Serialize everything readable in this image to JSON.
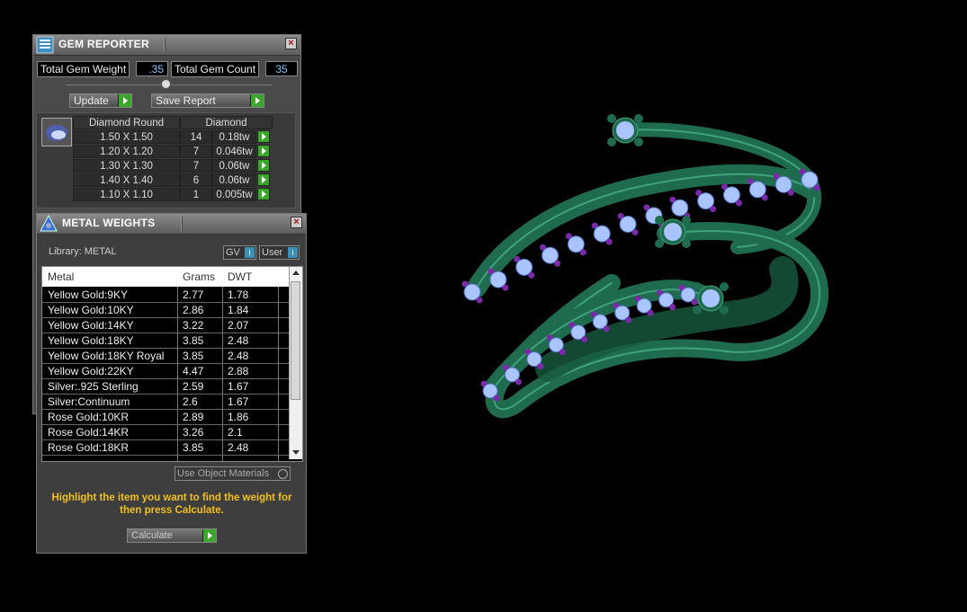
{
  "gem_reporter": {
    "title": "GEM REPORTER",
    "total_weight_label": "Total Gem Weight",
    "total_weight_value": ".35",
    "total_count_label": "Total Gem Count",
    "total_count_value": "35",
    "update_label": "Update",
    "save_label": "Save Report",
    "table": {
      "header_shape": "Diamond Round",
      "header_type": "Diamond",
      "rows": [
        {
          "size": "1.50 X 1.50",
          "qty": "14",
          "weight": "0.18tw"
        },
        {
          "size": "1.20 X 1.20",
          "qty": "7",
          "weight": "0.046tw"
        },
        {
          "size": "1.30 X 1.30",
          "qty": "7",
          "weight": "0.06tw"
        },
        {
          "size": "1.40 X 1.40",
          "qty": "6",
          "weight": "0.06tw"
        },
        {
          "size": "1.10 X 1.10",
          "qty": "1",
          "weight": "0.005tw"
        }
      ]
    }
  },
  "metal_weights": {
    "title": "METAL WEIGHTS",
    "library_label": "Library: METAL",
    "gv_label": "GV",
    "user_label": "User",
    "columns": [
      "Metal",
      "Grams",
      "DWT"
    ],
    "rows": [
      {
        "metal": "Yellow Gold:9KY",
        "grams": "2.77",
        "dwt": "1.78"
      },
      {
        "metal": "Yellow Gold:10KY",
        "grams": "2.86",
        "dwt": "1.84"
      },
      {
        "metal": "Yellow Gold:14KY",
        "grams": "3.22",
        "dwt": "2.07"
      },
      {
        "metal": "Yellow Gold:18KY",
        "grams": "3.85",
        "dwt": "2.48"
      },
      {
        "metal": "Yellow Gold:18KY Royal",
        "grams": "3.85",
        "dwt": "2.48"
      },
      {
        "metal": "Yellow Gold:22KY",
        "grams": "4.47",
        "dwt": "2.88"
      },
      {
        "metal": "Silver:.925 Sterling",
        "grams": "2.59",
        "dwt": "1.67"
      },
      {
        "metal": "Silver:Continuum",
        "grams": "2.6",
        "dwt": "1.67"
      },
      {
        "metal": "Rose Gold:10KR",
        "grams": "2.89",
        "dwt": "1.86"
      },
      {
        "metal": "Rose Gold:14KR",
        "grams": "3.26",
        "dwt": "2.1"
      },
      {
        "metal": "Rose Gold:18KR",
        "grams": "3.85",
        "dwt": "2.48"
      }
    ],
    "use_object_label": "Use Object Materials",
    "hint_text": "Highlight the item you want to find the weight for then press Calculate.",
    "calculate_label": "Calculate"
  },
  "colors": {
    "ring_metal": "#1f6b4e",
    "gem": "#a9c4ff",
    "prong": "#7a2aa8",
    "button_green": "#3aa62a",
    "hint": "#f0c020"
  }
}
